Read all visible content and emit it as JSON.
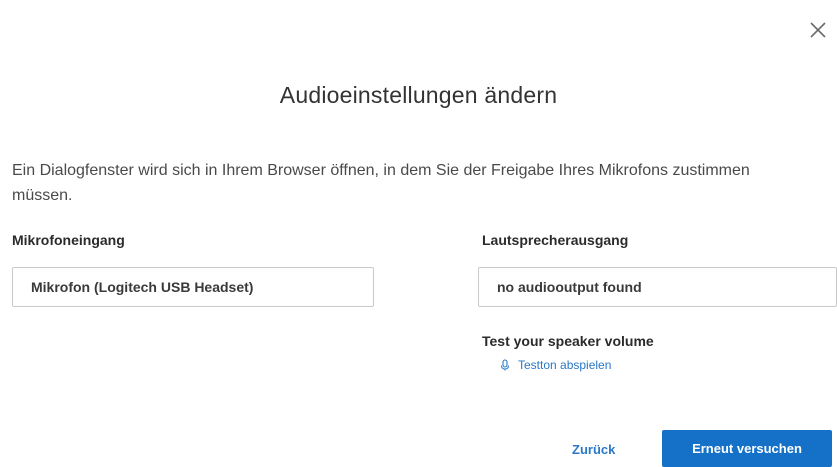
{
  "dialog": {
    "title": "Audioeinstellungen ändern",
    "description": "Ein Dialogfenster wird sich in Ihrem Browser öffnen, in dem Sie der Freigabe Ihres Mikrofons zustimmen müssen.",
    "close_icon": "close-icon"
  },
  "microphone": {
    "label": "Mikrofoneingang",
    "selected": "Mikrofon (Logitech USB Headset)"
  },
  "speaker": {
    "label": "Lautsprecherausgang",
    "selected": "no audiooutput found",
    "test_label": "Test your speaker volume",
    "test_link": "Testton abspielen",
    "test_icon": "speaker-icon"
  },
  "footer": {
    "back_label": "Zurück",
    "retry_label": "Erneut versuchen"
  },
  "colors": {
    "accent": "#1570c8",
    "link": "#2a78c7",
    "text": "#2d2d2d"
  }
}
